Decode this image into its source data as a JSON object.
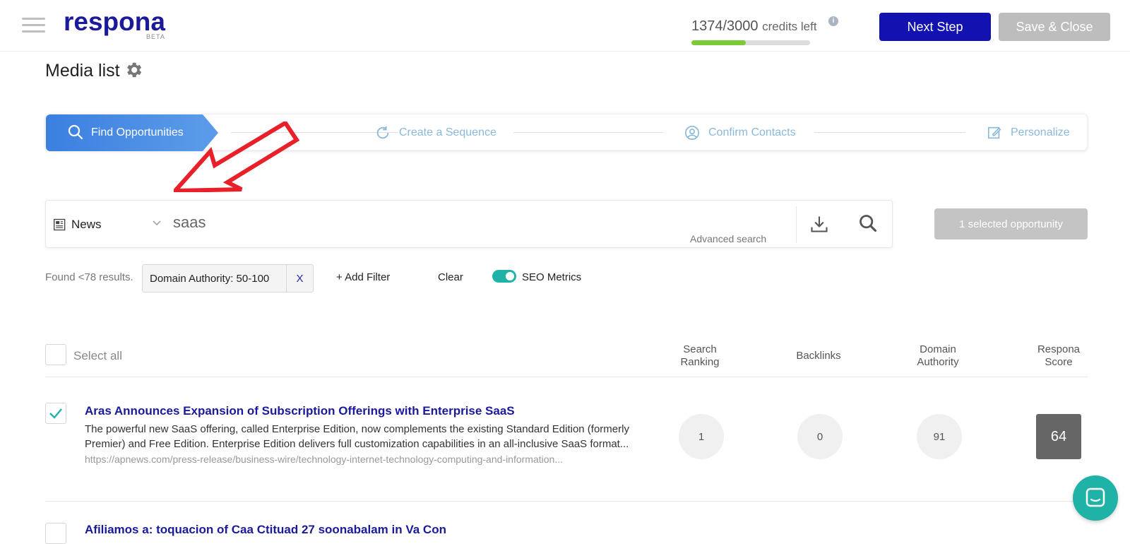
{
  "app": {
    "logo": "respona",
    "logo_badge": "BETA"
  },
  "header": {
    "credits_used": "1374/3000",
    "credits_label": "credits left",
    "credits_fraction": 0.458,
    "next_step_label": "Next Step",
    "save_close_label": "Save & Close"
  },
  "page": {
    "title": "Media list"
  },
  "stepper": {
    "steps": [
      {
        "label": "Find Opportunities",
        "active": true
      },
      {
        "label": "Create a Sequence",
        "active": false
      },
      {
        "label": "Confirm Contacts",
        "active": false
      },
      {
        "label": "Personalize",
        "active": false
      }
    ]
  },
  "search": {
    "source": "News",
    "query": "saas",
    "advanced_label": "Advanced search",
    "selected_label": "1 selected opportunity"
  },
  "filters": {
    "found_label": "Found <78 results.",
    "chip_label": "Domain Authority: 50-100",
    "chip_remove": "X",
    "add_filter_label": "+  Add Filter",
    "clear_label": "Clear",
    "seo_metrics_label": "SEO Metrics",
    "seo_metrics_on": true
  },
  "table": {
    "select_all_label": "Select all",
    "columns": [
      "Search Ranking",
      "Backlinks",
      "Domain Authority",
      "Respona Score"
    ],
    "rows": [
      {
        "checked": true,
        "title": "Aras Announces Expansion of Subscription Offerings with Enterprise SaaS",
        "description": "The powerful new SaaS offering, called Enterprise Edition, now complements the existing Standard Edition (formerly Premier) and Free Edition. Enterprise Edition delivers full customization capabilities in an all-inclusive SaaS format...",
        "url": "https://apnews.com/press-release/business-wire/technology-internet-technology-computing-and-information...",
        "search_ranking": "1",
        "backlinks": "0",
        "domain_authority": "91",
        "respona_score": "64"
      },
      {
        "checked": false,
        "title": "Afiliamos a: toquacion of Caa Ctituad 27 soonabalam in Va Con"
      }
    ]
  },
  "colors": {
    "brand": "#1a1a9a",
    "primary_button": "#1212b0",
    "teal": "#1fb3a8",
    "credit_fill": "#7cc93a"
  }
}
